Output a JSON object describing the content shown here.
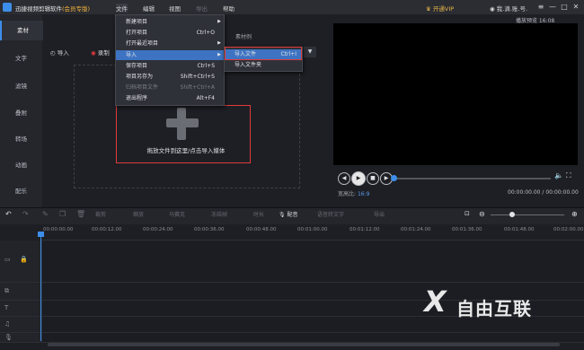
{
  "app": {
    "title": "迅捷视频剪辑软件",
    "edition": "(会员专版)",
    "menus": [
      "文件",
      "编辑",
      "视图",
      "导出",
      "帮助"
    ],
    "vip": "开通VIP",
    "account": "我.滴.账.号.",
    "window_buttons": [
      "≡",
      "—",
      "□",
      "✕"
    ]
  },
  "nav": [
    "素材",
    "文字",
    "滤镜",
    "叠附",
    "转场",
    "动画",
    "配乐"
  ],
  "media": {
    "import_label": "导入",
    "record_label": "录制",
    "sample_tab": "素材例",
    "drop_text": "拖放文件到这里/点击导入媒体"
  },
  "file_menu": {
    "items": [
      {
        "label": "新建项目",
        "shortcut": "",
        "has_sub": true,
        "disabled": false
      },
      {
        "label": "打开项目",
        "shortcut": "Ctrl+O",
        "has_sub": false,
        "disabled": false
      },
      {
        "label": "打开最近项目",
        "shortcut": "",
        "has_sub": true,
        "disabled": false
      },
      {
        "label": "导入",
        "shortcut": "",
        "has_sub": true,
        "disabled": false,
        "highlighted": true
      },
      {
        "label": "保存项目",
        "shortcut": "Ctrl+S",
        "has_sub": false,
        "disabled": false
      },
      {
        "label": "项目另存为",
        "shortcut": "Shift+Ctrl+S",
        "has_sub": false,
        "disabled": false
      },
      {
        "label": "归档项目文件",
        "shortcut": "Shift+Ctrl+A",
        "has_sub": false,
        "disabled": true
      },
      {
        "label": "退出程序",
        "shortcut": "Alt+F4",
        "has_sub": false,
        "disabled": false
      }
    ]
  },
  "import_submenu": {
    "items": [
      {
        "label": "导入文件",
        "shortcut": "Ctrl+I",
        "highlighted": true
      },
      {
        "label": "导入文件夹",
        "shortcut": ""
      }
    ]
  },
  "preview": {
    "time_label": "播放预览 16:08",
    "ratio_label": "宽高比:",
    "ratio_value": "16:9",
    "timecode": "00:00:00.00 / 00:00:00.00"
  },
  "toolbar": {
    "tools": [
      "裁剪",
      "缩放",
      "马赛克",
      "冻结帧",
      "时长",
      "配音",
      "语音转文字",
      "导出"
    ]
  },
  "timeline": {
    "ticks": [
      "00:00:00.00",
      "00:00:12.00",
      "00:00:24.00",
      "00:00:36.00",
      "00:00:48.00",
      "00:01:00.00",
      "00:01:12.00",
      "00:01:24.00",
      "00:01:36.00",
      "00:01:48.00",
      "00:02:00.00"
    ]
  },
  "watermark": "自由互联",
  "colors": {
    "accent": "#3d8eea",
    "highlight_box": "#e23b3b",
    "menu_hover": "#3d73c2",
    "vip": "#e9b649"
  }
}
